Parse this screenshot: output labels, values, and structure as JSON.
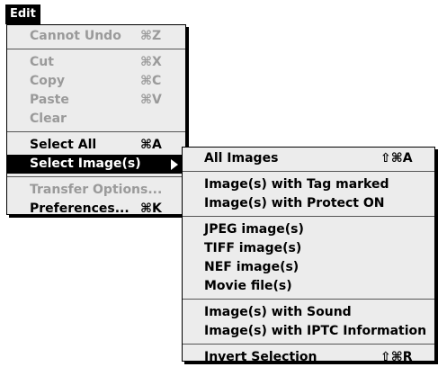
{
  "menubar": {
    "title": "Edit"
  },
  "edit_menu": {
    "cannot_undo": {
      "label": "Cannot Undo",
      "shortcut": "⌘Z"
    },
    "cut": {
      "label": "Cut",
      "shortcut": "⌘X"
    },
    "copy": {
      "label": "Copy",
      "shortcut": "⌘C"
    },
    "paste": {
      "label": "Paste",
      "shortcut": "⌘V"
    },
    "clear": {
      "label": "Clear"
    },
    "select_all": {
      "label": "Select All",
      "shortcut": "⌘A"
    },
    "select_images": {
      "label": "Select Image(s)"
    },
    "transfer_options": {
      "label": "Transfer Options..."
    },
    "preferences": {
      "label": "Preferences...",
      "shortcut": "⌘K"
    }
  },
  "submenu": {
    "all_images": {
      "label": "All Images",
      "shortcut": "⇧⌘A"
    },
    "tag_marked": {
      "label": "Image(s) with Tag marked"
    },
    "protect_on": {
      "label": "Image(s) with Protect ON"
    },
    "jpeg": {
      "label": "JPEG image(s)"
    },
    "tiff": {
      "label": "TIFF image(s)"
    },
    "nef": {
      "label": "NEF image(s)"
    },
    "movie": {
      "label": "Movie file(s)"
    },
    "with_sound": {
      "label": "Image(s) with Sound"
    },
    "iptc": {
      "label": "Image(s) with IPTC Information"
    },
    "invert": {
      "label": "Invert Selection",
      "shortcut": "⇧⌘R"
    }
  },
  "colors": {
    "disabled": "#9a9a9a",
    "menu_bg": "#ececec",
    "highlight": "#000000"
  }
}
